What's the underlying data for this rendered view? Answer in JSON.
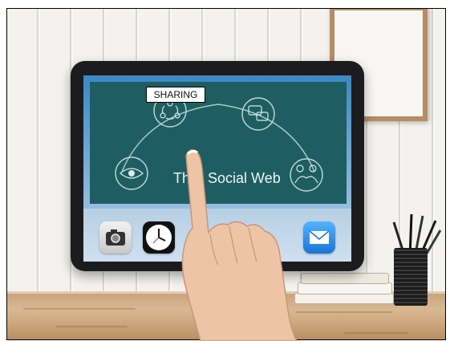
{
  "scene": {
    "description_elements": [
      "wall",
      "picture-frame",
      "table",
      "tablet",
      "hand",
      "pencil-cup",
      "books"
    ]
  },
  "tablet_screen": {
    "panel_title": "The Social Web",
    "panel_title_partial": "Th",
    "panel_title_rest": "Social Web",
    "highlight_label": "SHARING",
    "icons": [
      "share-icon",
      "chat-icon",
      "eye-icon",
      "handshake-icon"
    ],
    "dock_apps": [
      "camera-icon",
      "clock-icon",
      "mail-icon"
    ]
  },
  "colors": {
    "panel": "#1e5e63",
    "tablet_bezel": "#1c1c1e",
    "sky_top": "#3a88c4",
    "wood": "#d9b891",
    "frame_wood": "#b88b64"
  }
}
